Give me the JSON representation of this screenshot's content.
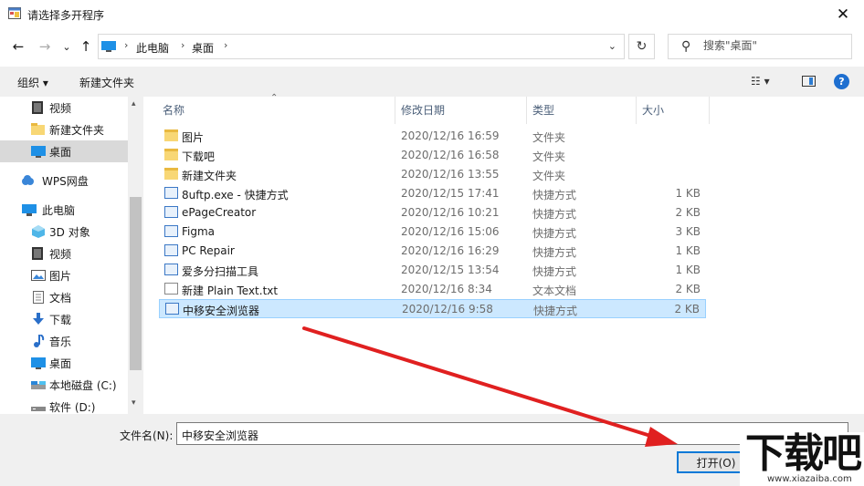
{
  "window": {
    "title": "请选择多开程序",
    "close": "✕"
  },
  "nav": {
    "back": "←",
    "forward": "→",
    "down": "⌄",
    "up": "↑"
  },
  "address": {
    "crumbs": [
      "此电脑",
      "桌面"
    ],
    "sep": "›",
    "dropdown": "⌄"
  },
  "refresh": "↻",
  "search": {
    "placeholder": "搜索\"桌面\"",
    "icon": "⚲"
  },
  "toolbar": {
    "organize": "组织 ▾",
    "new_folder": "新建文件夹",
    "view": "☷ ▾",
    "help": "?"
  },
  "sidebar": {
    "items": [
      {
        "label": "视频",
        "icon": "video-icon"
      },
      {
        "label": "新建文件夹",
        "icon": "folder-icon"
      },
      {
        "label": "桌面",
        "icon": "desktop-icon",
        "selected": true
      },
      {
        "label": "WPS网盘",
        "icon": "cloud-icon"
      },
      {
        "label": "此电脑",
        "icon": "computer-icon"
      },
      {
        "label": "3D 对象",
        "icon": "3d-objects-icon"
      },
      {
        "label": "视频",
        "icon": "video-icon"
      },
      {
        "label": "图片",
        "icon": "pictures-icon"
      },
      {
        "label": "文档",
        "icon": "documents-icon"
      },
      {
        "label": "下载",
        "icon": "download-icon"
      },
      {
        "label": "音乐",
        "icon": "music-icon"
      },
      {
        "label": "桌面",
        "icon": "desktop-icon"
      },
      {
        "label": "本地磁盘 (C:)",
        "icon": "drive-icon"
      },
      {
        "label": "软件 (D:)",
        "icon": "drive-icon"
      }
    ],
    "scroll_up": "▴",
    "scroll_down": "▾"
  },
  "columns": {
    "name": "名称",
    "date": "修改日期",
    "type": "类型",
    "size": "大小",
    "sort": "⌃"
  },
  "files": [
    {
      "name": "图片",
      "date": "2020/12/16 16:59",
      "type": "文件夹",
      "size": "",
      "kind": "folder"
    },
    {
      "name": "下载吧",
      "date": "2020/12/16 16:58",
      "type": "文件夹",
      "size": "",
      "kind": "folder"
    },
    {
      "name": "新建文件夹",
      "date": "2020/12/16 13:55",
      "type": "文件夹",
      "size": "",
      "kind": "folder"
    },
    {
      "name": "8uftp.exe - 快捷方式",
      "date": "2020/12/15 17:41",
      "type": "快捷方式",
      "size": "1 KB",
      "kind": "shortcut"
    },
    {
      "name": "ePageCreator",
      "date": "2020/12/16 10:21",
      "type": "快捷方式",
      "size": "2 KB",
      "kind": "shortcut"
    },
    {
      "name": "Figma",
      "date": "2020/12/16 15:06",
      "type": "快捷方式",
      "size": "3 KB",
      "kind": "shortcut"
    },
    {
      "name": "PC Repair",
      "date": "2020/12/16 16:29",
      "type": "快捷方式",
      "size": "1 KB",
      "kind": "shortcut"
    },
    {
      "name": "爱多分扫描工具",
      "date": "2020/12/15 13:54",
      "type": "快捷方式",
      "size": "1 KB",
      "kind": "shortcut"
    },
    {
      "name": "新建 Plain Text.txt",
      "date": "2020/12/16 8:34",
      "type": "文本文档",
      "size": "2 KB",
      "kind": "text"
    },
    {
      "name": "中移安全浏览器",
      "date": "2020/12/16 9:58",
      "type": "快捷方式",
      "size": "2 KB",
      "kind": "shortcut",
      "selected": true
    }
  ],
  "filename": {
    "label": "文件名(N):",
    "value": "中移安全浏览器",
    "dropdown": "⌄"
  },
  "open_button": "打开(O)",
  "watermark": {
    "text": "下载吧",
    "url": "www.xiazaiba.com"
  },
  "colors": {
    "selection": "#cce8ff",
    "accent": "#0078d7",
    "arrow": "#e02020"
  }
}
